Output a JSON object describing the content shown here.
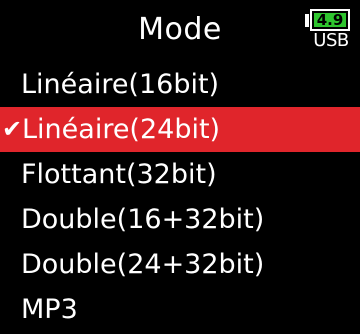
{
  "header": {
    "title": "Mode",
    "battery": {
      "value": "4.9",
      "source": "USB",
      "level": 1.0,
      "fill_color": "#2fc52f"
    }
  },
  "menu": {
    "items": [
      {
        "label": "Linéaire(16bit)",
        "selected": false
      },
      {
        "label": "Linéaire(24bit)",
        "selected": true
      },
      {
        "label": "Flottant(32bit)",
        "selected": false
      },
      {
        "label": "Double(16+32bit)",
        "selected": false
      },
      {
        "label": "Double(24+32bit)",
        "selected": false
      },
      {
        "label": "MP3",
        "selected": false
      }
    ],
    "check_glyph": "✔",
    "selected_color": "#e0252b"
  }
}
